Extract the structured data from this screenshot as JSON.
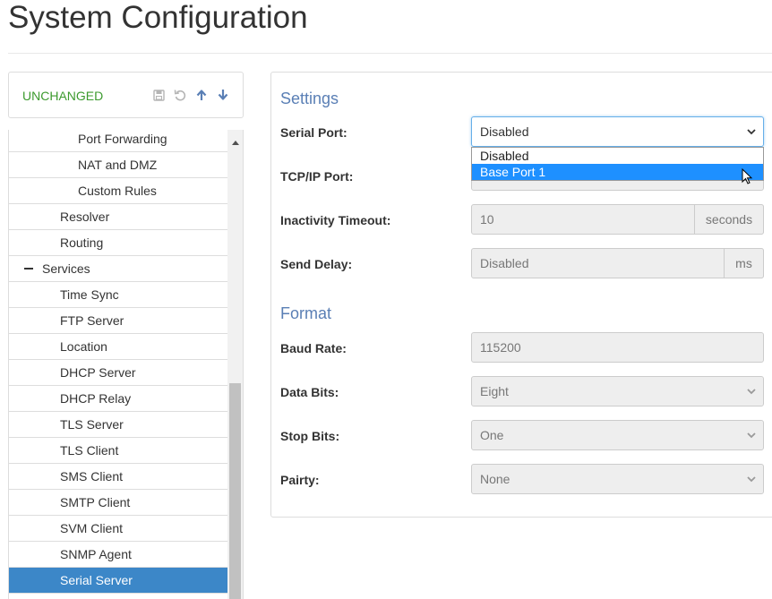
{
  "page": {
    "title": "System Configuration"
  },
  "status": {
    "text": "UNCHANGED",
    "actions": [
      "save-icon",
      "undo-icon",
      "arrow-up-icon",
      "arrow-down-icon"
    ],
    "color": "#3c9a2e"
  },
  "nav": {
    "items": [
      {
        "label": "Port Forwarding",
        "level": 3
      },
      {
        "label": "NAT and DMZ",
        "level": 3
      },
      {
        "label": "Custom Rules",
        "level": 3
      },
      {
        "label": "Resolver",
        "level": 2
      },
      {
        "label": "Routing",
        "level": 2
      },
      {
        "label": "Services",
        "level": 1,
        "expanded": true
      },
      {
        "label": "Time Sync",
        "level": 2
      },
      {
        "label": "FTP Server",
        "level": 2
      },
      {
        "label": "Location",
        "level": 2
      },
      {
        "label": "DHCP Server",
        "level": 2
      },
      {
        "label": "DHCP Relay",
        "level": 2
      },
      {
        "label": "TLS Server",
        "level": 2
      },
      {
        "label": "TLS Client",
        "level": 2
      },
      {
        "label": "SMS Client",
        "level": 2
      },
      {
        "label": "SMTP Client",
        "level": 2
      },
      {
        "label": "SVM Client",
        "level": 2
      },
      {
        "label": "SNMP Agent",
        "level": 2
      },
      {
        "label": "Serial Server",
        "level": 2,
        "active": true
      }
    ],
    "active_color": "#3c87c8"
  },
  "settings": {
    "title": "Settings",
    "serial_port": {
      "label": "Serial Port:",
      "value": "Disabled",
      "options": [
        "Disabled",
        "Base Port 1"
      ],
      "highlighted": "Base Port 1"
    },
    "tcp_port": {
      "label": "TCP/IP Port:",
      "value": ""
    },
    "inactivity_timeout": {
      "label": "Inactivity Timeout:",
      "value": "10",
      "unit": "seconds"
    },
    "send_delay": {
      "label": "Send Delay:",
      "value": "Disabled",
      "unit": "ms"
    }
  },
  "format": {
    "title": "Format",
    "baud_rate": {
      "label": "Baud Rate:",
      "value": "115200"
    },
    "data_bits": {
      "label": "Data Bits:",
      "value": "Eight"
    },
    "stop_bits": {
      "label": "Stop Bits:",
      "value": "One"
    },
    "parity": {
      "label": "Pairty:",
      "value": "None"
    }
  },
  "colors": {
    "section_title": "#5a7fb5",
    "highlight": "#1e90ff"
  }
}
